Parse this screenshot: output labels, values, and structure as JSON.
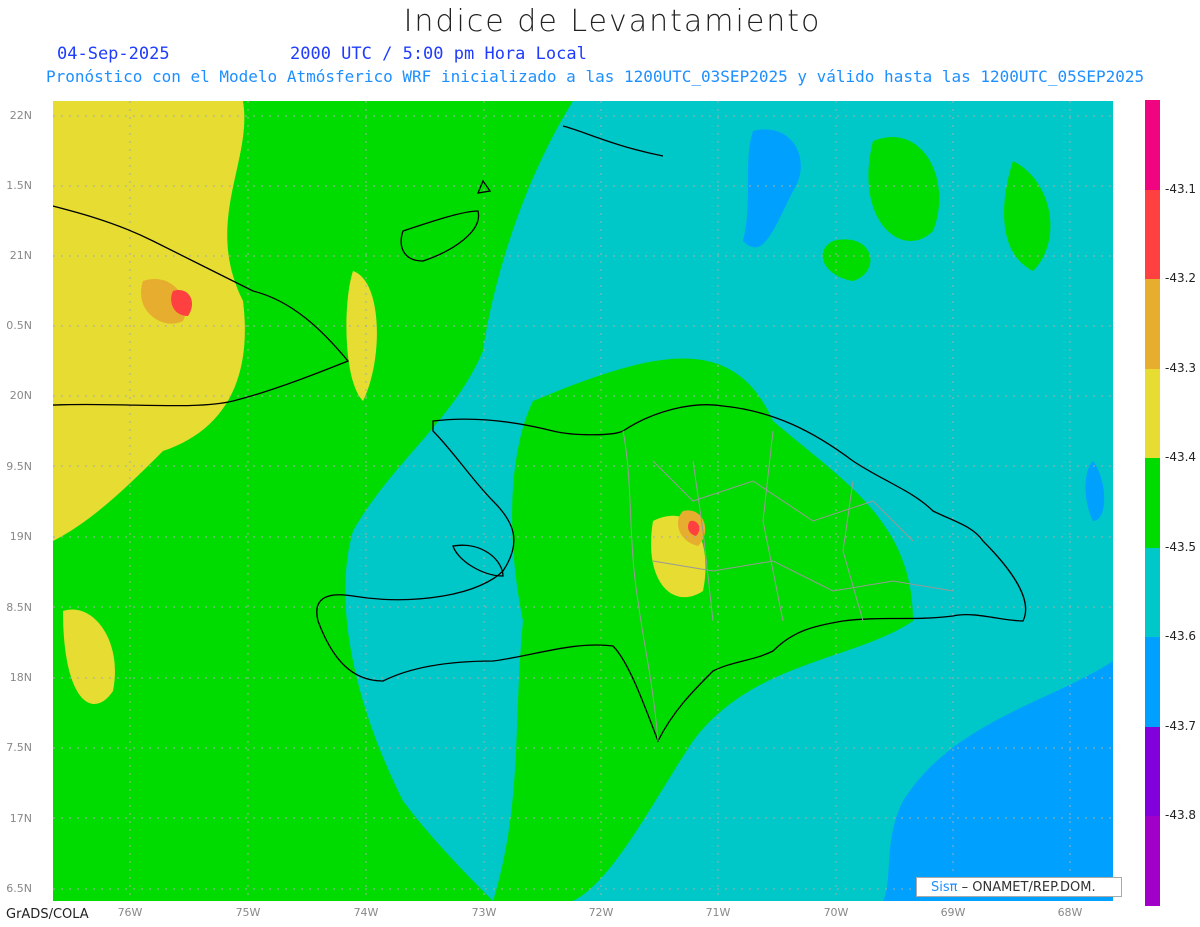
{
  "title": "Indice de Levantamiento",
  "date": "04-Sep-2025",
  "time": "2000 UTC / 5:00 pm Hora Local",
  "subtitle": "Pronóstico con el Modelo Atmósferico WRF inicializado a las 1200UTC_03SEP2025 y válido hasta las  1200UTC_05SEP2025",
  "lat_labels": [
    "22N",
    "1.5N",
    "21N",
    "0.5N",
    "20N",
    "9.5N",
    "19N",
    "8.5N",
    "18N",
    "7.5N",
    "17N",
    "6.5N"
  ],
  "lon_labels": [
    "76W",
    "75W",
    "74W",
    "73W",
    "72W",
    "71W",
    "70W",
    "69W",
    "68W"
  ],
  "colorbar": {
    "colors": [
      "#f0047f",
      "#ff4040",
      "#e6ad2e",
      "#e6dc32",
      "#00dc00",
      "#00c8c8",
      "#00a0ff",
      "#8200dc",
      "#a000c8"
    ],
    "labels": [
      "-43.1",
      "-43.2",
      "-43.3",
      "-43.4",
      "-43.5",
      "-43.6",
      "-43.7",
      "-43.8"
    ]
  },
  "credit": "GrADS/COLA",
  "logo": {
    "brand": "Sisπ",
    "text": " –  ONAMET/REP.DOM."
  }
}
